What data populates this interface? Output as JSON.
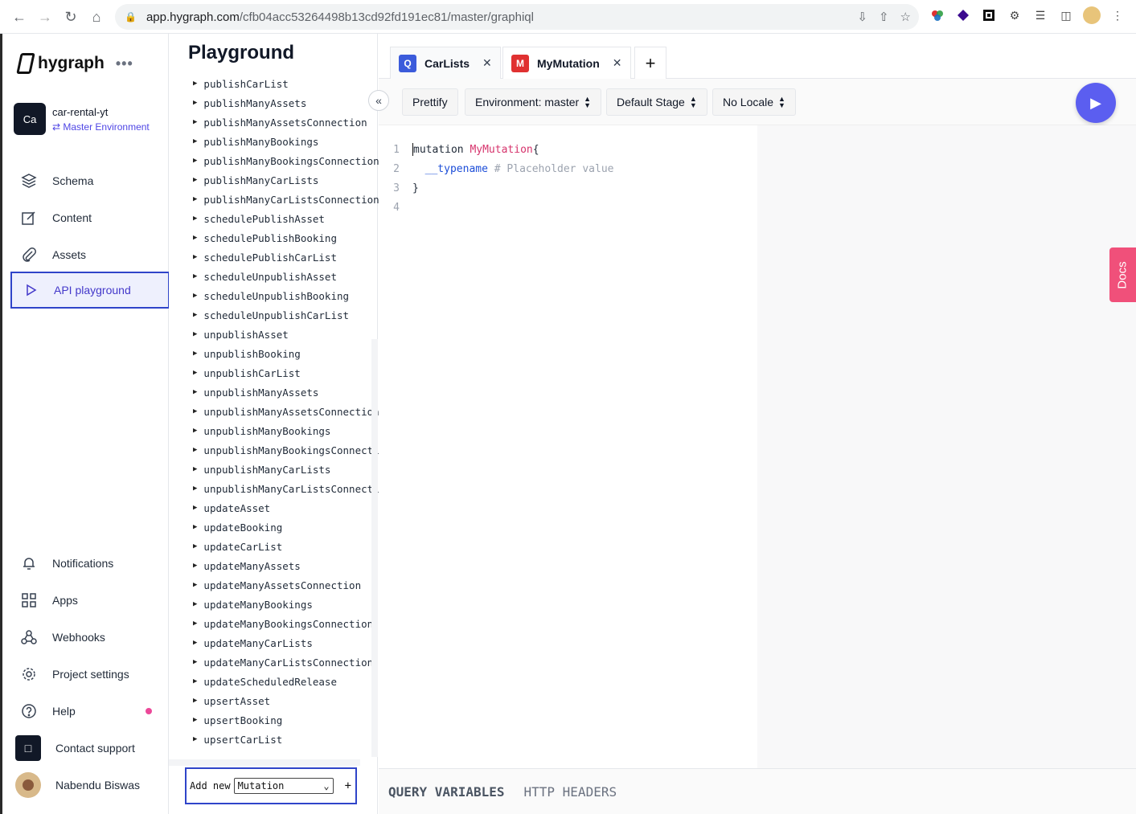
{
  "browser": {
    "url_host": "app.hygraph.com",
    "url_path": "/cfb04acc53264498b13cd92fd191ec81/master/graphiql"
  },
  "sidebar": {
    "brand": "hygraph",
    "project_badge": "Ca",
    "project_name": "car-rental-yt",
    "environment": "Master Environment",
    "top_items": [
      {
        "label": "Schema",
        "icon": "layers-icon"
      },
      {
        "label": "Content",
        "icon": "edit-icon"
      },
      {
        "label": "Assets",
        "icon": "paperclip-icon"
      },
      {
        "label": "API playground",
        "icon": "play-icon"
      }
    ],
    "bottom_items": [
      {
        "label": "Notifications",
        "icon": "bell-icon"
      },
      {
        "label": "Apps",
        "icon": "apps-grid-icon"
      },
      {
        "label": "Webhooks",
        "icon": "webhook-icon"
      },
      {
        "label": "Project settings",
        "icon": "gear-icon"
      },
      {
        "label": "Help",
        "icon": "help-icon"
      },
      {
        "label": "Contact support",
        "icon": "chat-icon"
      },
      {
        "label": "Nabendu Biswas",
        "icon": "user-avatar"
      }
    ],
    "accent_color": "#2f44c9",
    "notification_dot_color": "#ec4899"
  },
  "explorer": {
    "title": "Playground",
    "items": [
      "publishCarList",
      "publishManyAssets",
      "publishManyAssetsConnection",
      "publishManyBookings",
      "publishManyBookingsConnection",
      "publishManyCarLists",
      "publishManyCarListsConnection",
      "schedulePublishAsset",
      "schedulePublishBooking",
      "schedulePublishCarList",
      "scheduleUnpublishAsset",
      "scheduleUnpublishBooking",
      "scheduleUnpublishCarList",
      "unpublishAsset",
      "unpublishBooking",
      "unpublishCarList",
      "unpublishManyAssets",
      "unpublishManyAssetsConnection",
      "unpublishManyBookings",
      "unpublishManyBookingsConnecti",
      "unpublishManyCarLists",
      "unpublishManyCarListsConnecti",
      "updateAsset",
      "updateBooking",
      "updateCarList",
      "updateManyAssets",
      "updateManyAssetsConnection",
      "updateManyBookings",
      "updateManyBookingsConnection",
      "updateManyCarLists",
      "updateManyCarListsConnection",
      "updateScheduledRelease",
      "upsertAsset",
      "upsertBooking",
      "upsertCarList"
    ],
    "add_new_label": "Add new",
    "add_new_selected": "Mutation",
    "add_new_plus": "+"
  },
  "tabs": [
    {
      "badge": "Q",
      "badge_color": "#3b5bdb",
      "label": "CarLists",
      "close": "✕"
    },
    {
      "badge": "M",
      "badge_color": "#e03131",
      "label": "MyMutation",
      "close": "✕"
    }
  ],
  "toolbar": {
    "prettify": "Prettify",
    "environment": "Environment: master",
    "stage": "Default Stage",
    "locale": "No Locale",
    "run_color": "#5b5ef0"
  },
  "editor": {
    "lines": [
      {
        "num": "1",
        "kw": "mutation",
        "def": "MyMutation",
        "rest": " {"
      },
      {
        "num": "2",
        "field": "__typename",
        "comment": "# Placeholder value"
      },
      {
        "num": "3",
        "text": "}"
      },
      {
        "num": "4",
        "text": ""
      }
    ]
  },
  "docs_tab": "Docs",
  "bottom_pane": {
    "query_variables": "QUERY VARIABLES",
    "http_headers": "HTTP HEADERS"
  }
}
